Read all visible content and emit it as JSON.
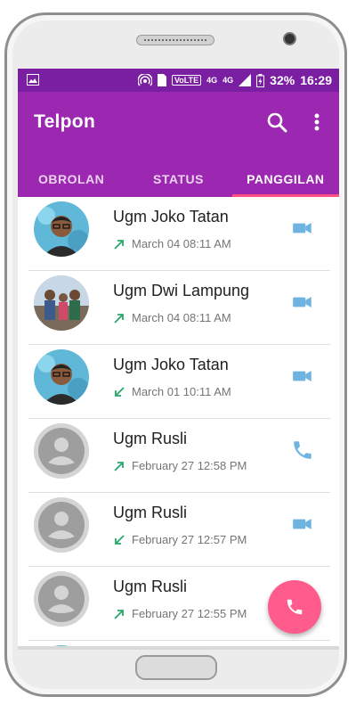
{
  "status_bar": {
    "battery": "32%",
    "time": "16:29",
    "network": "4G",
    "volte": "VoLTE",
    "data_type": "4G"
  },
  "app_bar": {
    "title": "Telpon",
    "icons": [
      "search-icon",
      "more-vert-icon"
    ]
  },
  "tabs": [
    {
      "label": "OBROLAN",
      "active": false
    },
    {
      "label": "STATUS",
      "active": false
    },
    {
      "label": "PANGGILAN",
      "active": true
    }
  ],
  "calls": [
    {
      "name": "Ugm Joko Tatan",
      "time": "March 04 08:11 AM",
      "direction": "outgoing",
      "type": "video",
      "avatar": "photo-man-glasses"
    },
    {
      "name": "Ugm Dwi Lampung",
      "time": "March 04 08:11 AM",
      "direction": "outgoing",
      "type": "video",
      "avatar": "photo-family"
    },
    {
      "name": "Ugm Joko Tatan",
      "time": "March 01 10:11 AM",
      "direction": "incoming",
      "type": "video",
      "avatar": "photo-man-glasses"
    },
    {
      "name": "Ugm Rusli",
      "time": "February 27 12:58 PM",
      "direction": "outgoing",
      "type": "voice",
      "avatar": "default"
    },
    {
      "name": "Ugm Rusli",
      "time": "February 27 12:57 PM",
      "direction": "incoming",
      "type": "video",
      "avatar": "default"
    },
    {
      "name": "Ugm Rusli",
      "time": "February 27 12:55 PM",
      "direction": "outgoing",
      "type": "video",
      "avatar": "default"
    }
  ],
  "fab": {
    "icon": "phone-icon"
  },
  "colors": {
    "status_bar": "#7a1fa2",
    "app_bar": "#9c27b0",
    "tab_indicator": "#ff4f84",
    "fab": "#ff5c8d",
    "call_arrow": "#26a96c",
    "action_icon": "#6fb3e0"
  }
}
